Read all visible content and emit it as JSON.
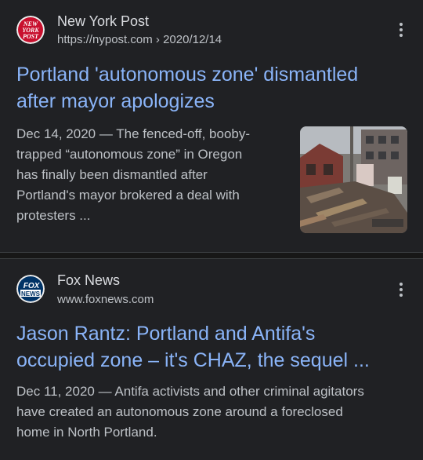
{
  "results": [
    {
      "site_name": "New York Post",
      "url_base": "https://nypost.com",
      "url_sep": " › ",
      "url_path": "2020/12/14",
      "favicon_text": [
        "NEW",
        "YORK",
        "POST"
      ],
      "favicon_color": "#c8102e",
      "title_lines": [
        "Portland 'autonomous zone' dismantled",
        "after mayor apologizes"
      ],
      "date": "Dec 14, 2020",
      "snippet_lines": [
        "— The fenced-off, booby-",
        "trapped “autonomous zone” in Oregon",
        "has finally been dismantled after",
        "Portland's mayor brokered a deal with",
        "protesters ..."
      ],
      "has_thumbnail": true
    },
    {
      "site_name": "Fox News",
      "url_base": "www.foxnews.com",
      "favicon_text": [
        "FOX",
        "NEWS"
      ],
      "favicon_color": "#003366",
      "title_lines": [
        "Jason Rantz: Portland and Antifa's",
        "occupied zone – it's CHAZ, the sequel ..."
      ],
      "date": "Dec 11, 2020",
      "snippet_lines": [
        "— Antifa activists and other criminal agitators",
        "have created an autonomous zone around a foreclosed",
        "home in North Portland."
      ]
    }
  ],
  "theme": {
    "background": "#202124",
    "title_color": "#8ab4f8",
    "text_color": "#bdc1c6"
  }
}
